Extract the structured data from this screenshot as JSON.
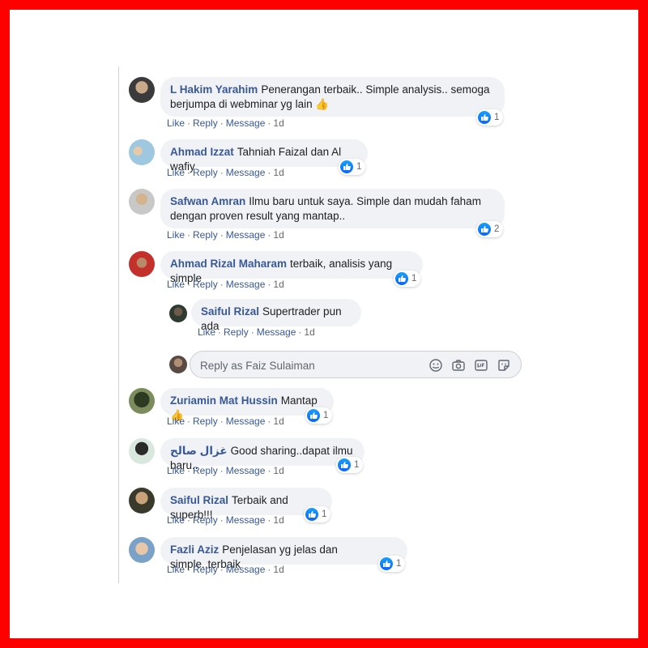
{
  "comments": [
    {
      "name": "L Hakim Yarahim",
      "line1": "Penerangan terbaik.. Simple analysis.. semoga",
      "line2": "berjumpa di webminar yg lain 👍",
      "reactions": "1",
      "time": "1d"
    },
    {
      "name": "Ahmad Izzat",
      "text": "Tahniah Faizal dan Al wafiy",
      "reactions": "1",
      "time": "1d"
    },
    {
      "name": "Safwan Amran",
      "line1": "Ilmu baru untuk saya. Simple dan mudah faham",
      "line2": "dengan proven result yang mantap..",
      "reactions": "2",
      "time": "1d"
    },
    {
      "name": "Ahmad Rizal Maharam",
      "text": "terbaik, analisis yang simple",
      "reactions": "1",
      "time": "1d"
    },
    {
      "name": "Saiful Rizal",
      "text": "Supertrader pun ada",
      "time": "1d"
    },
    {
      "name": "Zuriamin Mat Hussin",
      "text": "Mantap 👍",
      "reactions": "1",
      "time": "1d"
    },
    {
      "name": "غزال صالح",
      "text": "Good sharing..dapat ilmu baru..",
      "reactions": "1",
      "time": "1d"
    },
    {
      "name": "Saiful Rizal",
      "text": "Terbaik and superb!!!",
      "reactions": "1",
      "time": "1d"
    },
    {
      "name": "Fazli Aziz",
      "text": "Penjelasan yg jelas dan simple..terbaik",
      "reactions": "1",
      "time": "1d"
    }
  ],
  "actions": {
    "like": "Like",
    "reply": "Reply",
    "message": "Message",
    "dot": "·"
  },
  "reply_box": {
    "placeholder": "Reply as Faiz Sulaiman"
  },
  "colors": {
    "frame": "#ff0000",
    "name": "#385898",
    "bubble": "#f0f2f5",
    "like_blue": "#0866ff"
  }
}
